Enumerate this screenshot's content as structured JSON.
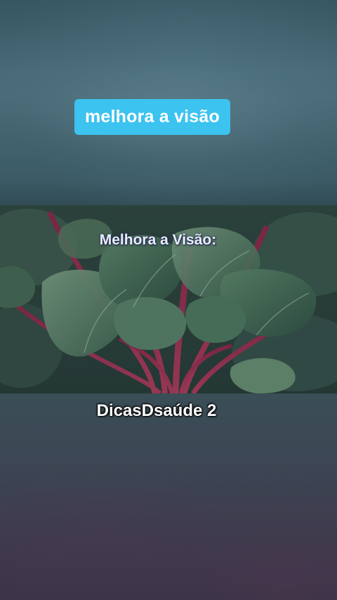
{
  "overlay": {
    "caption": "melhora a visão"
  },
  "photo": {
    "subject_icon": "chard-leaves-photo",
    "title": "Melhora a Visão:"
  },
  "watermark": {
    "text": "DicasDsaúde 2"
  },
  "colors": {
    "caption_background": "#3cc3ef",
    "caption_text": "#ffffff",
    "background_top": "#3e5f6b",
    "background_bottom": "#3b3447",
    "leaf_green": "#4f7a5e",
    "stem_red": "#a3254a"
  }
}
